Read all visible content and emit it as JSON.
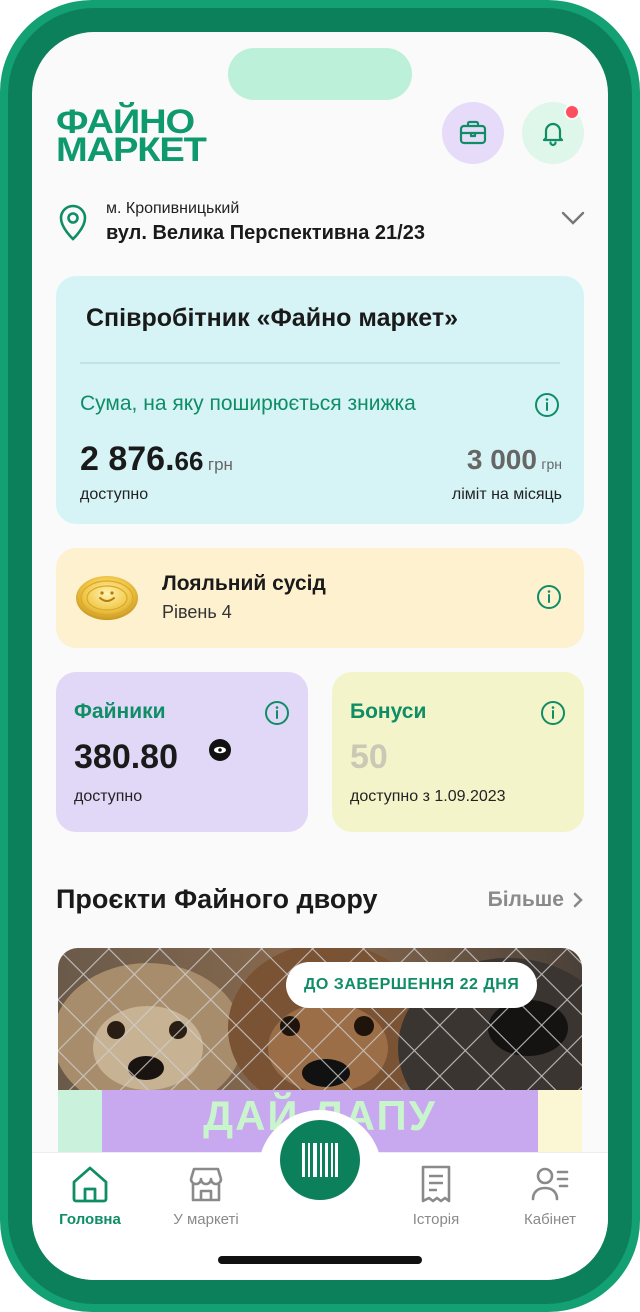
{
  "header": {
    "logo_line1": "ФАЙНО",
    "logo_line2": "МАРКЕТ",
    "briefcase_icon": "briefcase-icon",
    "bell_icon": "bell-icon"
  },
  "address": {
    "city": "м. Кропивницький",
    "street": "вул. Велика Перспективна 21/23"
  },
  "employee": {
    "title": "Співробітник «Файно маркет»",
    "subtitle": "Сума, на яку поширюється знижка",
    "amount_int": "2 876.",
    "amount_dec": "66",
    "currency": "грн",
    "available_label": "доступно",
    "limit_value": "3 000",
    "limit_currency": "грн",
    "limit_label": "ліміт на місяць"
  },
  "loyalty": {
    "title": "Лояльний сусід",
    "level": "Рівень 4"
  },
  "fainyky": {
    "title": "Файники",
    "value": "380.80",
    "label": "доступно"
  },
  "bonuses": {
    "title": "Бонуси",
    "value": "50",
    "label": "доступно з 1.09.2023"
  },
  "projects": {
    "title": "Проєкти Файного двору",
    "more": "Більше",
    "badge": "ДО ЗАВЕРШЕННЯ 22 ДНЯ",
    "banner_text": "ДАЙ ЛАПУ"
  },
  "tabs": [
    {
      "label": "Головна",
      "icon": "home-icon",
      "active": true
    },
    {
      "label": "У маркеті",
      "icon": "store-icon",
      "active": false
    },
    {
      "label": "Історія",
      "icon": "receipt-icon",
      "active": false
    },
    {
      "label": "Кабінет",
      "icon": "profile-icon",
      "active": false
    }
  ],
  "colors": {
    "brand_green": "#0f9a6e",
    "frame_green": "#13a073",
    "accent_text": "#0f8d65"
  }
}
